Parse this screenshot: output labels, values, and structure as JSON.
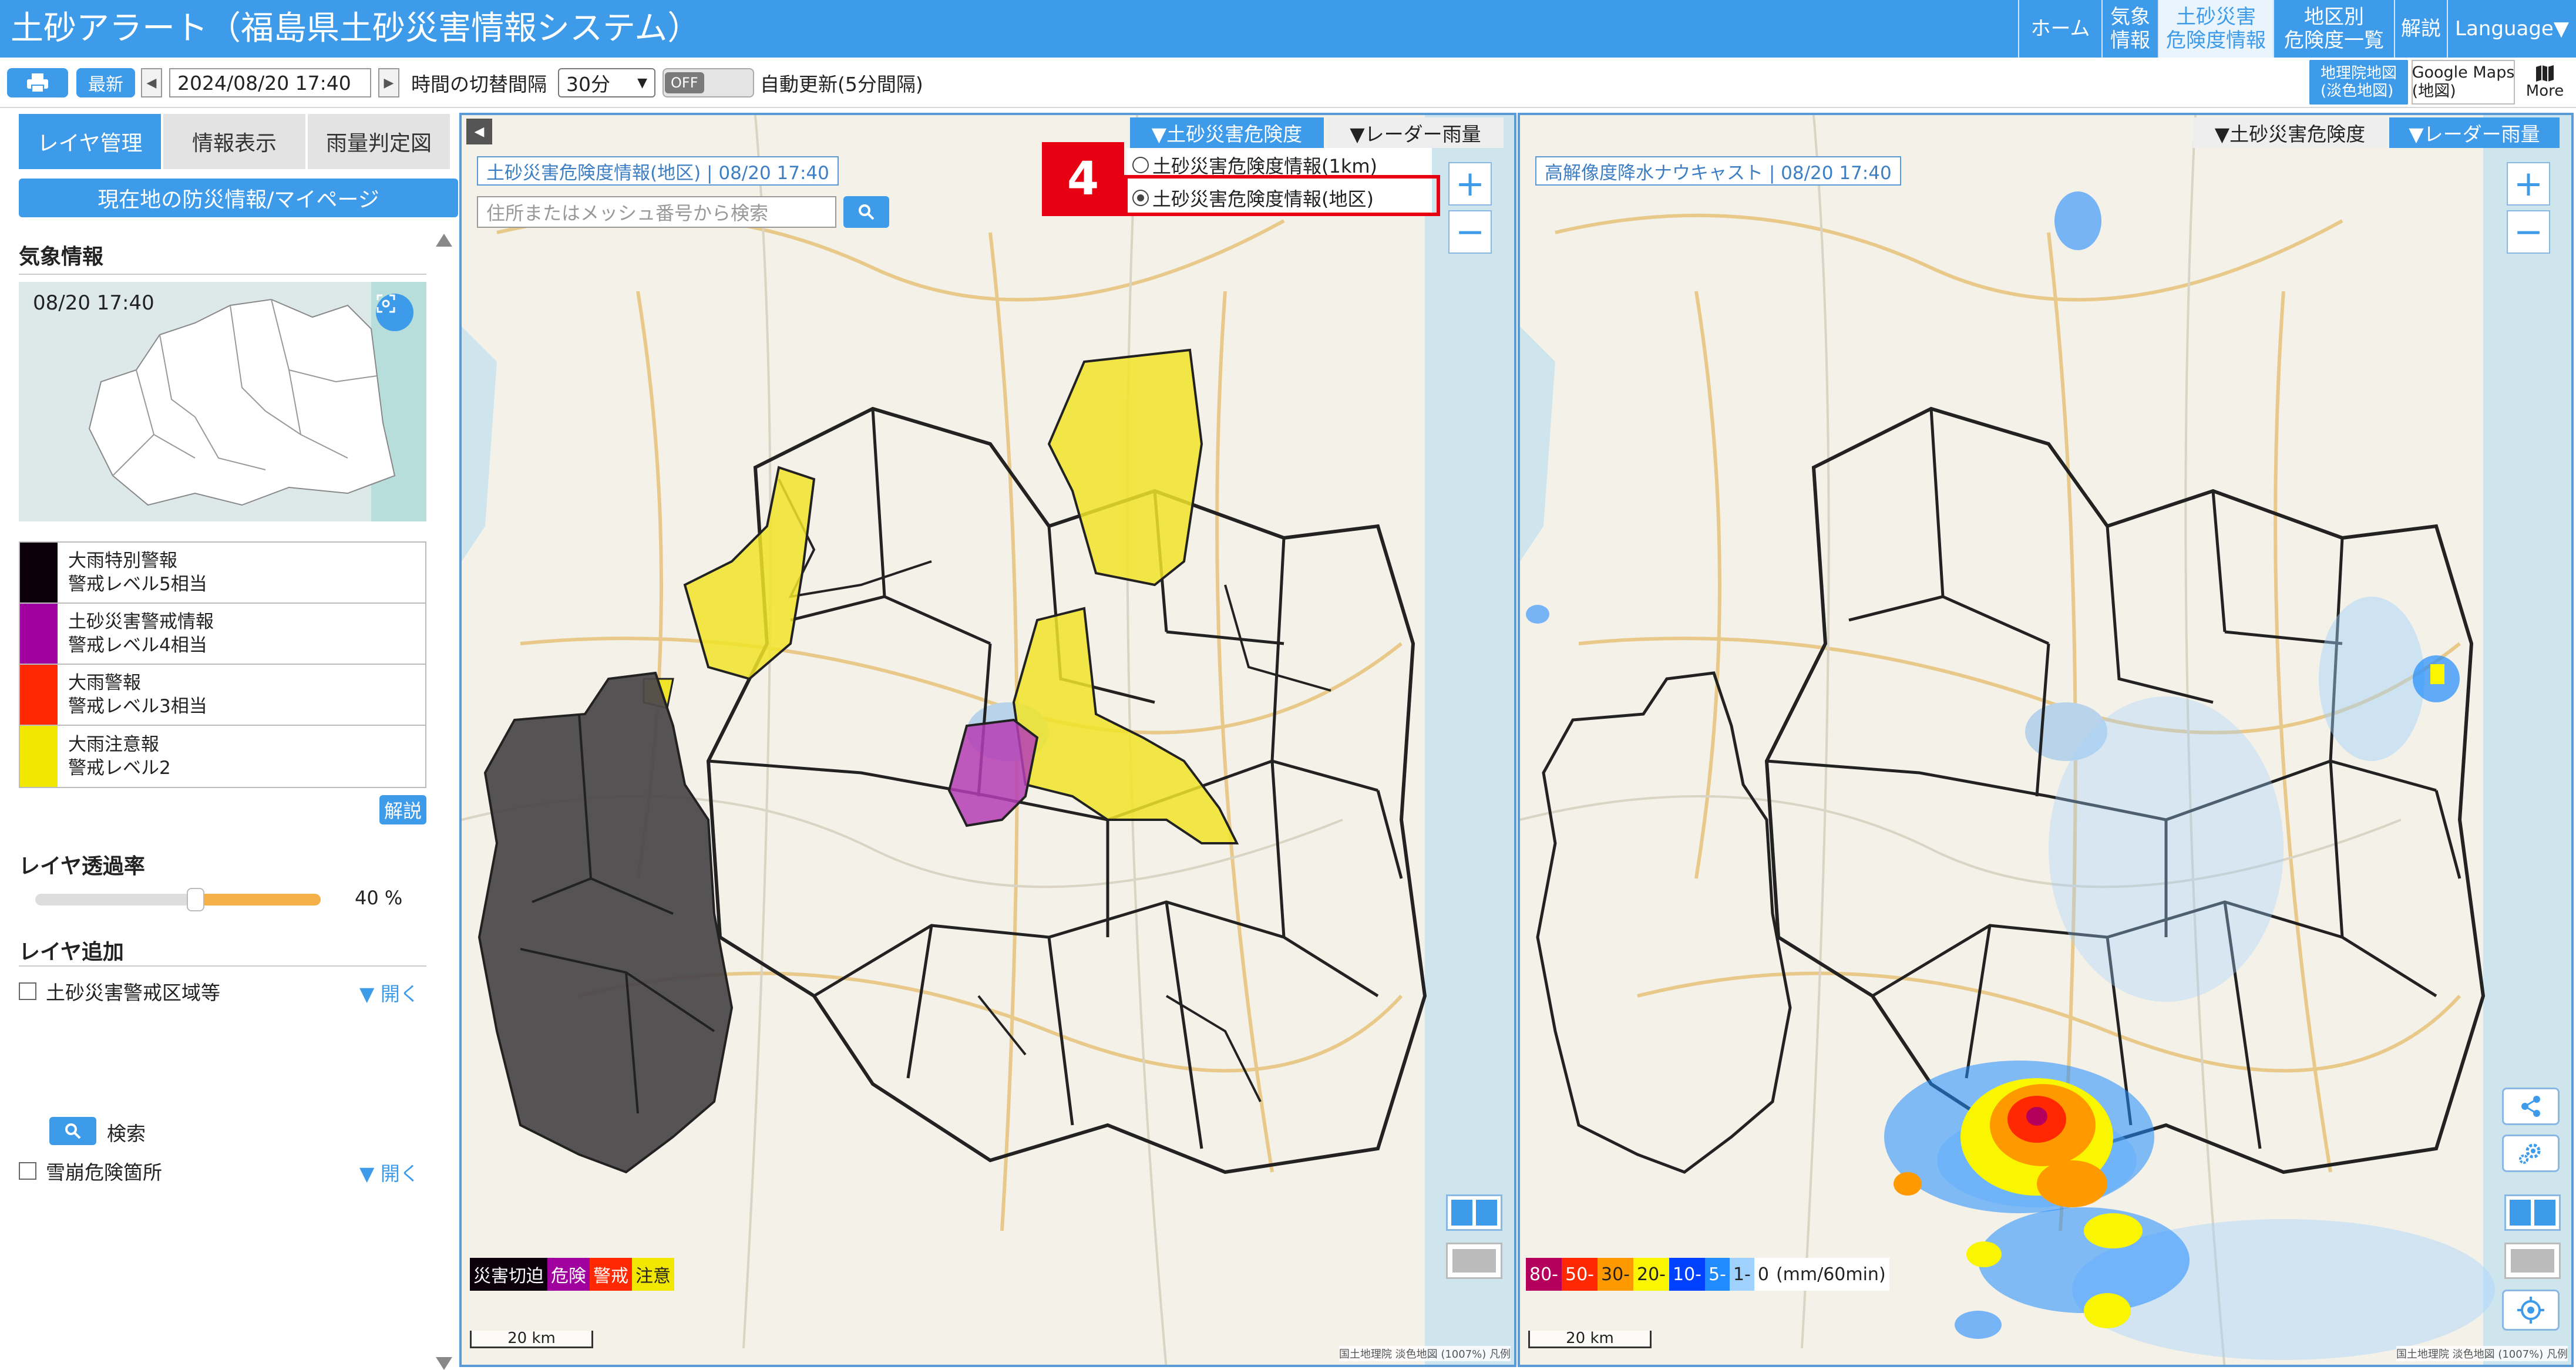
{
  "header": {
    "title": "土砂アラート（福島県土砂災害情報システム）",
    "nav": [
      {
        "label": "ホーム"
      },
      {
        "label": "気象\n情報"
      },
      {
        "label": "土砂災害\n危険度情報"
      },
      {
        "label": "地区別\n危険度一覧"
      },
      {
        "label": "解説"
      },
      {
        "label": "Language▼"
      }
    ]
  },
  "toolbar": {
    "latest_label": "最新",
    "datetime": "2024/08/20 17:40",
    "interval_label": "時間の切替間隔",
    "interval_value": "30分",
    "toggle_label": "OFF",
    "auto_update_label": "自動更新(5分間隔)",
    "gsi_label": "地理院地図\n(淡色地図)",
    "gmaps_label": "Google Maps\n(地図)",
    "more_label": "More"
  },
  "sidebar": {
    "tabs": [
      {
        "label": "レイヤ管理"
      },
      {
        "label": "情報表示"
      },
      {
        "label": "雨量判定図"
      }
    ],
    "mypage_label": "現在地の防災情報/マイページ",
    "weather_title": "気象情報",
    "weather_time": "08/20 17:40",
    "legend": [
      {
        "line1": "大雨特別警報",
        "line2": "警戒レベル5相当",
        "color": "#0c000c"
      },
      {
        "line1": "土砂災害警戒情報",
        "line2": "警戒レベル4相当",
        "color": "#a0009e"
      },
      {
        "line1": "大雨警報",
        "line2": "警戒レベル3相当",
        "color": "#ff2800"
      },
      {
        "line1": "大雨注意報",
        "line2": "警戒レベル2",
        "color": "#f2e700"
      }
    ],
    "help_label": "解説",
    "opacity_title": "レイヤ透過率",
    "opacity_value": "40 %",
    "opacity_fraction": 0.4,
    "add_layer_title": "レイヤ追加",
    "layers": [
      {
        "label": "土砂災害警戒区域等",
        "open_label": "▼ 開く"
      },
      {
        "label": "雪崩危険箇所",
        "open_label": "▼ 開く"
      }
    ],
    "search_label": "検索"
  },
  "map_left": {
    "label": "土砂災害危険度情報(地区) | 08/20 17:40",
    "search_placeholder": "住所またはメッシュ番号から検索",
    "tab_risk": "▼土砂災害危険度",
    "tab_radar": "▼レーダー雨量",
    "radio_1km": "土砂災害危険度情報(1km)",
    "radio_area": "土砂災害危険度情報(地区)",
    "step_badge": "4",
    "legend": [
      {
        "label": "災害切迫",
        "bg": "#0c000c",
        "fg": "#ffffff"
      },
      {
        "label": "危険",
        "bg": "#a0009e",
        "fg": "#ffffff"
      },
      {
        "label": "警戒",
        "bg": "#ff2800",
        "fg": "#ffffff"
      },
      {
        "label": "注意",
        "bg": "#f2e700",
        "fg": "#222222"
      }
    ],
    "scale": "20 km",
    "attribution": "国土地理院 淡色地図 (1007%)  凡例"
  },
  "map_right": {
    "label": "高解像度降水ナウキャスト | 08/20 17:40",
    "tab_risk": "▼土砂災害危険度",
    "tab_radar": "▼レーダー雨量",
    "legend": [
      {
        "label": "80-",
        "bg": "#b4005c",
        "fg": "#ffffff"
      },
      {
        "label": "50-",
        "bg": "#ff2800",
        "fg": "#ffffff"
      },
      {
        "label": "30-",
        "bg": "#ff9900",
        "fg": "#222222"
      },
      {
        "label": "20-",
        "bg": "#faf500",
        "fg": "#222222"
      },
      {
        "label": "10-",
        "bg": "#0041ff",
        "fg": "#ffffff"
      },
      {
        "label": "5-",
        "bg": "#218cff",
        "fg": "#ffffff"
      },
      {
        "label": "1-",
        "bg": "#a0d2ff",
        "fg": "#222222"
      },
      {
        "label": "0",
        "bg": "#ffffff",
        "fg": "#222222"
      }
    ],
    "unit": "(mm/60min)",
    "scale": "20 km",
    "attribution": "国土地理院 淡色地図 (1007%)  凡例"
  },
  "colors": {
    "accent": "#3d9be9",
    "highlight": "#e60012",
    "map_base": "#f4f1e8",
    "sea": "#cfe5ee"
  },
  "icons": [
    "print-icon",
    "search-icon",
    "fullscreen-icon",
    "share-icon",
    "settings-icon",
    "locate-icon",
    "map-icon"
  ]
}
